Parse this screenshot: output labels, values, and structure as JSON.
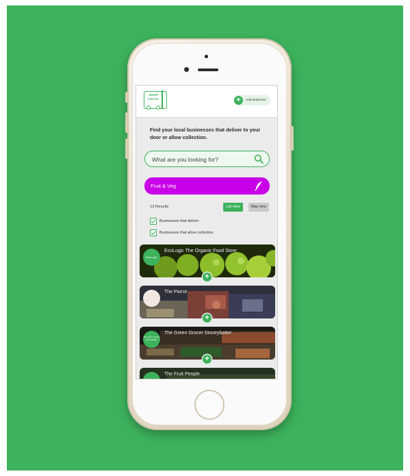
{
  "header": {
    "logo_text": "SHOP LOCAL",
    "add_business_label": "Add Business"
  },
  "intro_text": "Find your local businesses that deliver to your door or allow collection.",
  "search": {
    "placeholder": "What are you looking for?"
  },
  "category": {
    "label": "Fruit & Veg"
  },
  "results": {
    "count_label": "13 Results",
    "list_view_label": "List view",
    "map_view_label": "Map view"
  },
  "filters": [
    {
      "label": "Businesses that deliver",
      "checked": true
    },
    {
      "label": "Businesses that allow collection",
      "checked": true
    }
  ],
  "businesses": [
    {
      "name": "EcoLogic The Organic Food Store",
      "logo_text": "EcoLogic"
    },
    {
      "name": "The Parrot",
      "logo_text": ""
    },
    {
      "name": "The Green Grocer Stoneybatter",
      "logo_text": "The Green Grocer Stoneybatter"
    },
    {
      "name": "The Fruit People",
      "logo_text": ""
    }
  ],
  "colors": {
    "background": "#3db25c",
    "accent": "#3db25c",
    "category": "#c800e8"
  },
  "icons": {
    "search": "search-icon",
    "category": "feather-icon",
    "add": "plus-icon",
    "check": "check-icon"
  }
}
